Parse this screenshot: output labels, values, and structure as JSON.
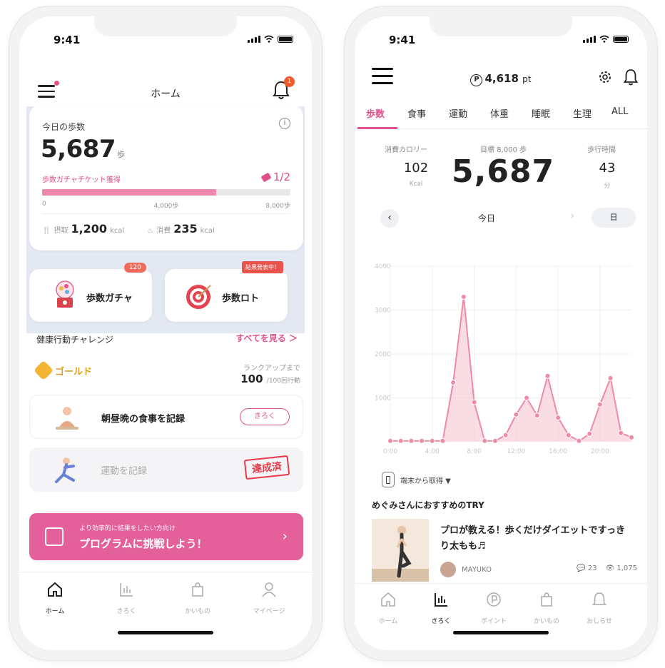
{
  "left": {
    "status": {
      "time": "9:41"
    },
    "header": {
      "title": "ホーム",
      "bell_badge": "1"
    },
    "steps_card": {
      "label": "今日の歩数",
      "steps": "5,687",
      "unit": "歩",
      "ticket_text": "歩数ガチャチケット獲得",
      "ticket_count": "1/2",
      "progress_fraction": 0.7,
      "ticks": [
        "0",
        "4,000歩",
        "8,000歩"
      ],
      "intake_label": "摂取",
      "intake_value": "1,200",
      "intake_unit": "kcal",
      "burn_label": "消費",
      "burn_value": "235",
      "burn_unit": "kcal"
    },
    "gacha": {
      "label": "歩数ガチャ",
      "badge": "120"
    },
    "lotto": {
      "label": "歩数ロト",
      "badge": "結果発表中！"
    },
    "challenge": {
      "title": "健康行動チャレンジ",
      "more": "すべてを見る ＞",
      "rank_name": "ゴールド",
      "rank_up_label": "ランクアップまで",
      "rank_value": "100",
      "rank_total": "/100回行動"
    },
    "tasks": [
      {
        "label": "朝昼晩の食事を記録",
        "button": "きろく"
      },
      {
        "label": "運動を記録",
        "stamp": "達成済"
      }
    ],
    "promo": {
      "small": "より効率的に結果をしたい方向け",
      "big": "プログラムに挑戦しよう！",
      "arrow": "›"
    },
    "tabbar": [
      {
        "label": "ホーム",
        "icon": "home-icon",
        "active": true
      },
      {
        "label": "きろく",
        "icon": "chart-icon",
        "active": false
      },
      {
        "label": "かいもの",
        "icon": "shopping-bag-icon",
        "active": false
      },
      {
        "label": "マイページ",
        "icon": "person-icon",
        "active": false
      }
    ]
  },
  "right": {
    "status": {
      "time": "9:41"
    },
    "header": {
      "points": "4,618",
      "points_unit": "pt",
      "points_icon_letter": "P"
    },
    "tabs": [
      "歩数",
      "食事",
      "運動",
      "体重",
      "睡眠",
      "生理",
      "ALL"
    ],
    "metrics": {
      "calorie_label": "消費カロリー",
      "calorie_value": "102",
      "calorie_unit": "Kcal",
      "goal_label": "目標 8,000 歩",
      "steps_value": "5,687",
      "time_label": "歩行時間",
      "time_value": "43",
      "time_unit": "分"
    },
    "date_nav": {
      "prev": "‹",
      "label": "今日",
      "next": "›",
      "unit": "日"
    },
    "source": {
      "label": "端末から取得 ▼"
    },
    "recommend": {
      "title": "めぐみさんにおすすめのTRY",
      "article": "プロが教える！歩くだけダイエットですっきり太もも♬",
      "author": "MAYUKO",
      "comments": "23",
      "views": "1,075"
    },
    "tabbar": [
      {
        "label": "ホーム",
        "icon": "home-icon",
        "active": false
      },
      {
        "label": "きろく",
        "icon": "chart-icon",
        "active": true
      },
      {
        "label": "ポイント",
        "icon": "point-icon",
        "active": false
      },
      {
        "label": "かいもの",
        "icon": "shopping-bag-icon",
        "active": false
      },
      {
        "label": "おしらせ",
        "icon": "bell-icon",
        "active": false
      }
    ]
  },
  "colors": {
    "accent": "#e0508c",
    "chart_line": "#ef8aa4",
    "chart_fill": "#f7c6d2"
  },
  "chart_data": {
    "type": "area",
    "x": [
      "0:00",
      "1:00",
      "2:00",
      "3:00",
      "4:00",
      "5:00",
      "6:00",
      "7:00",
      "8:00",
      "9:00",
      "10:00",
      "11:00",
      "12:00",
      "13:00",
      "14:00",
      "15:00",
      "16:00",
      "17:00",
      "18:00",
      "19:00",
      "20:00",
      "21:00",
      "22:00",
      "23:00"
    ],
    "x_tick_labels": [
      "0:00",
      "4:00",
      "8:00",
      "12:00",
      "16:00",
      "20:00"
    ],
    "y_tick_labels": [
      "1000",
      "2000",
      "3000",
      "4000"
    ],
    "ylim": [
      0,
      4000
    ],
    "grid": true,
    "series": [
      {
        "values": [
          20,
          20,
          20,
          20,
          20,
          20,
          1350,
          3300,
          900,
          20,
          20,
          150,
          620,
          1000,
          600,
          1500,
          550,
          150,
          20,
          180,
          850,
          1450,
          200,
          100
        ]
      }
    ]
  }
}
